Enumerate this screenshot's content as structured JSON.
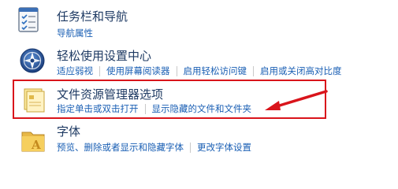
{
  "items": [
    {
      "title": "任务栏和导航",
      "icon": "taskbar-checklist-icon",
      "links": [
        "导航属性"
      ]
    },
    {
      "title": "轻松使用设置中心",
      "icon": "ease-of-access-icon",
      "links": [
        "适应弱视",
        "使用屏幕阅读器",
        "启用轻松访问键",
        "启用或关闭高对比度"
      ]
    },
    {
      "title": "文件资源管理器选项",
      "icon": "folder-options-icon",
      "links": [
        "指定单击或双击打开",
        "显示隐藏的文件和文件夹"
      ]
    },
    {
      "title": "字体",
      "icon": "fonts-folder-icon",
      "links": [
        "预览、删除或者显示和隐藏字体",
        "更改字体设置"
      ]
    }
  ],
  "colors": {
    "title": "#1e3a63",
    "link": "#1a5fb4",
    "highlight": "#d9141b"
  }
}
